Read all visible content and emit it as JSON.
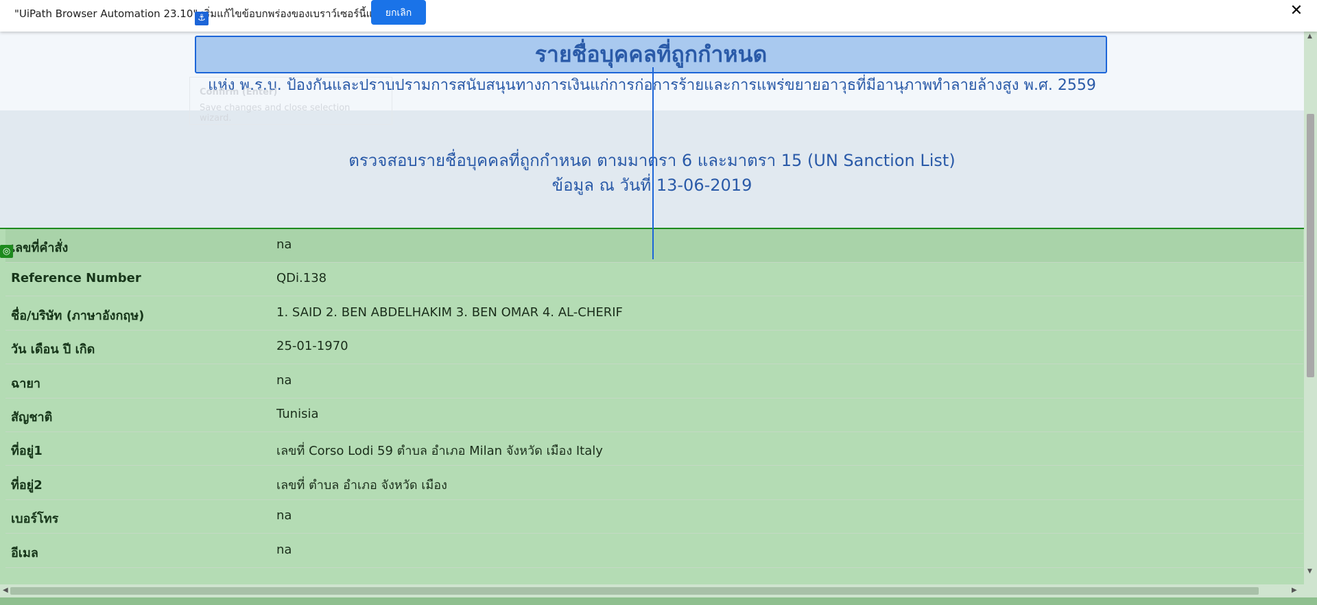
{
  "infobar": {
    "message": "\"UiPath Browser Automation 23.10\" เริ่มแก้ไขข้อบกพร่องของเบราว์เซอร์นี้แล้ว",
    "cancel_label": "ยกเลิก",
    "close_glyph": "✕"
  },
  "header": {
    "title": "รายชื่อบุคคลที่ถูกกำหนด",
    "act": "แห่ง พ.ร.บ. ป้องกันและปราบปรามการสนับสนุนทางการเงินแก่การก่อการร้ายและการแพร่ขยายอาวุธที่มีอานุภาพทำลายล้างสูง พ.ศ. 2559"
  },
  "tooltip": {
    "title": "Confirm (Enter)",
    "description": "Save changes and close selection wizard."
  },
  "section": {
    "line1": "ตรวจสอบรายชื่อบุคคลที่ถูกกำหนด ตามมาตรา 6 และมาตรา 15 (UN Sanction List)",
    "line2": "ข้อมูล ณ วันที่ 13-06-2019"
  },
  "table": {
    "rows": [
      {
        "label": "เลขที่คำสั่ง",
        "value": "na"
      },
      {
        "label": "Reference Number",
        "value": "QDi.138"
      },
      {
        "label": "ชื่อ/บริษัท (ภาษาอังกฤษ)",
        "value": "1. SAID 2. BEN ABDELHAKIM 3. BEN OMAR 4. AL-CHERIF"
      },
      {
        "label": "วัน เดือน ปี เกิด",
        "value": "25-01-1970"
      },
      {
        "label": "ฉายา",
        "value": "na"
      },
      {
        "label": "สัญชาติ",
        "value": "Tunisia"
      },
      {
        "label": "ที่อยู่1",
        "value": "เลขที่ Corso Lodi 59 ตำบล อำเภอ Milan จังหวัด เมือง Italy"
      },
      {
        "label": "ที่อยู่2",
        "value": "เลขที่ ตำบล อำเภอ จังหวัด เมือง"
      },
      {
        "label": "เบอร์โทร",
        "value": "na"
      },
      {
        "label": "อีเมล",
        "value": "na"
      }
    ]
  },
  "icons": {
    "anchor": "anchor-icon",
    "target": "target-icon"
  },
  "colors": {
    "selection_blue": "#1c65d8",
    "selection_green": "#1d8a1d",
    "title_text": "#2a5aa8",
    "table_bg": "#b4dcb4"
  }
}
